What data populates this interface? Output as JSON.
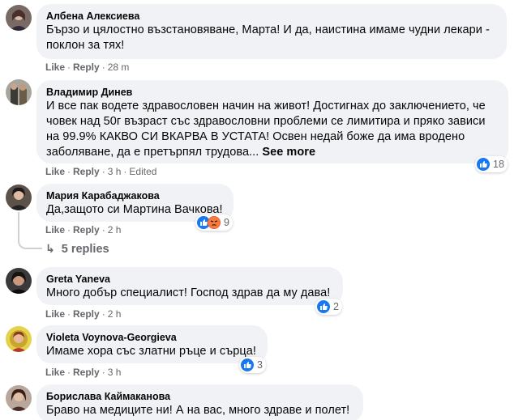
{
  "actions": {
    "like": "Like",
    "reply": "Reply",
    "sep": "·"
  },
  "comments": [
    {
      "author": "Албена Алексиева",
      "lines": [
        "Бързо и цялостно възстановяване, Марта! И да, наистина имаме чудни лекари -",
        "поклон за тях!"
      ],
      "time": "28 m"
    },
    {
      "author": "Владимир Динев",
      "lines": [
        "И все пак водете здравословен начин на живот! Достигнах до заключението, че",
        "човек над 50г възраст със здравословни проблеми се лимитира и пряко зависи",
        "на 99.9% КАКВО СИ ВКАРВА В УСТАТА! Освен недай боже да има вродено",
        "заболяване, да е претърпял трудова..."
      ],
      "see_more": "See more",
      "time": "3 h",
      "edited": "Edited",
      "reaction_count": "18"
    },
    {
      "author": "Мария Карабаджакова",
      "lines": [
        "Да,защото си Мартина Вачкова!"
      ],
      "time": "2 h",
      "reaction_count": "9"
    },
    {
      "author": "Greta Yaneva",
      "lines": [
        "Много добър специалист! Господ здрав да му дава!"
      ],
      "time": "2 h",
      "reaction_count": "2"
    },
    {
      "author": "Violeta Voynova-Georgieva",
      "lines": [
        "Имаме хора със златни ръце и сърца!"
      ],
      "time": "3 h",
      "reaction_count": "3"
    },
    {
      "author": "Борислава Каймаканова",
      "lines": [
        "Браво на медиците ни! А на вас, много здраве и полет!"
      ]
    }
  ],
  "replies_link": "5 replies",
  "colors": {
    "bubble": "#f0f2f5",
    "meta": "#65676b",
    "like_blue": "#1877f2",
    "angry": "#f5533d"
  }
}
